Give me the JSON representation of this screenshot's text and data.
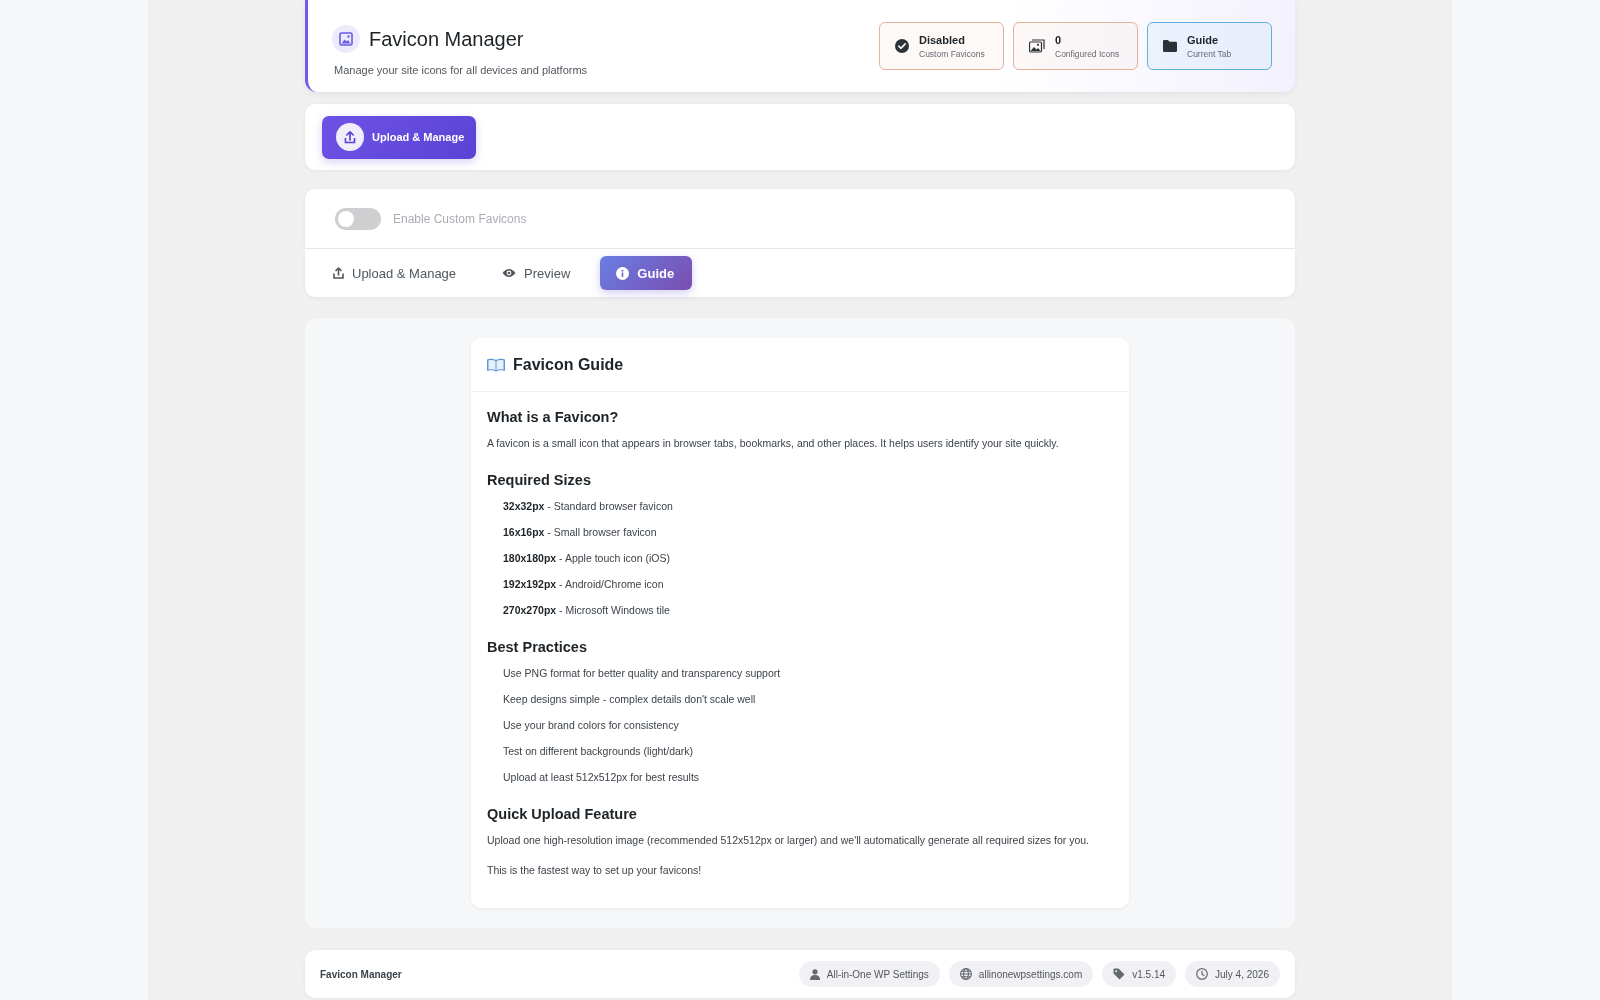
{
  "header": {
    "title": "Favicon Manager",
    "subtitle": "Manage your site icons for all devices and platforms",
    "stats": [
      {
        "kind": "status",
        "value": "Disabled",
        "label": "Custom Favicons",
        "color": "#e6b19c"
      },
      {
        "kind": "count",
        "value": "0",
        "label": "Configured Icons",
        "color": "#e6b19c"
      },
      {
        "kind": "tab",
        "value": "Guide",
        "label": "Current Tab",
        "color": "#5eb2e2"
      }
    ]
  },
  "upload_bar": {
    "button": "Upload & Manage"
  },
  "toggle": {
    "label": "Enable Custom Favicons",
    "on": false
  },
  "tabs": [
    {
      "kind": "upload",
      "label": "Upload & Manage",
      "selected": false
    },
    {
      "kind": "preview",
      "label": "Preview",
      "selected": false
    },
    {
      "kind": "guide",
      "label": "Guide",
      "selected": true
    }
  ],
  "guide": {
    "title": "Favicon Guide",
    "sections": [
      {
        "kind": "text",
        "heading": "What is a Favicon?",
        "paragraphs": [
          "A favicon is a small icon that appears in browser tabs, bookmarks, and other places. It helps users identify your site quickly."
        ]
      },
      {
        "kind": "list",
        "heading": "Required Sizes",
        "items": [
          "**32x32px** - Standard browser favicon",
          "**16x16px** - Small browser favicon",
          "**180x180px** - Apple touch icon (iOS)",
          "**192x192px** - Android/Chrome icon",
          "**270x270px** - Microsoft Windows tile"
        ]
      },
      {
        "kind": "list",
        "heading": "Best Practices",
        "items": [
          "Use PNG format for better quality and transparency support",
          "Keep designs simple - complex details don't scale well",
          "Use your brand colors for consistency",
          "Test on different backgrounds (light/dark)",
          "Upload at least 512x512px for best results"
        ]
      },
      {
        "kind": "text",
        "heading": "Quick Upload Feature",
        "paragraphs": [
          "Upload one high-resolution image (recommended 512x512px or larger) and we'll automatically generate all required sizes for you.",
          "This is the fastest way to set up your favicons!"
        ]
      }
    ]
  },
  "footer": {
    "title": "Favicon Manager",
    "chips": [
      {
        "kind": "author",
        "text": "All-in-One WP Settings"
      },
      {
        "kind": "site",
        "text": "allinonewpsettings.com"
      },
      {
        "kind": "version",
        "text": "v1.5.14"
      },
      {
        "kind": "date",
        "text": "July 4, 2026"
      }
    ]
  }
}
